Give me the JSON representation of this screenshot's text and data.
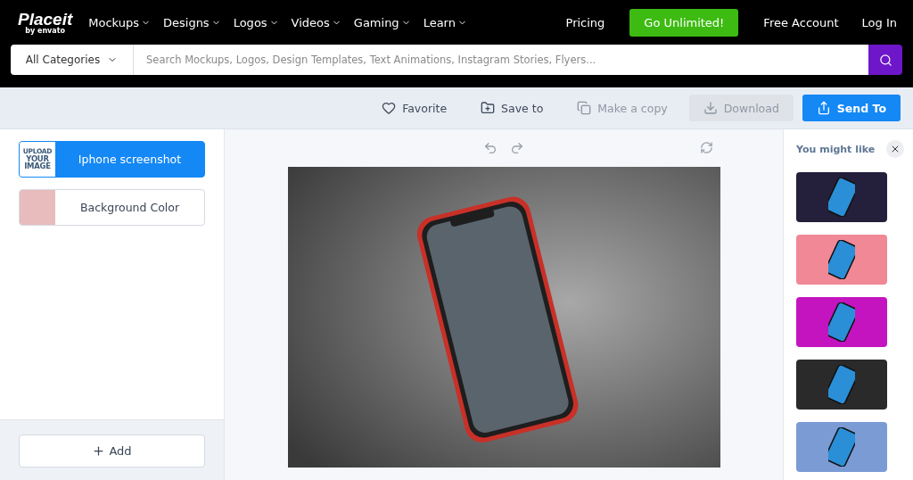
{
  "brand": {
    "name": "Placeit",
    "byline": "by",
    "partner": "envato"
  },
  "nav": [
    {
      "label": "Mockups"
    },
    {
      "label": "Designs"
    },
    {
      "label": "Logos"
    },
    {
      "label": "Videos"
    },
    {
      "label": "Gaming"
    },
    {
      "label": "Learn"
    }
  ],
  "top_links": [
    {
      "kind": "link",
      "label": "Pricing"
    },
    {
      "kind": "cta",
      "label": "Go Unlimited!"
    },
    {
      "kind": "link",
      "label": "Free Account"
    },
    {
      "kind": "link",
      "label": "Log In"
    }
  ],
  "search": {
    "category": "All Categories",
    "placeholder": "Search Mockups, Logos, Design Templates, Text Animations, Instagram Stories, Flyers..."
  },
  "toolbar": [
    {
      "kind": "favorite",
      "label": "Favorite",
      "disabled": false
    },
    {
      "kind": "save",
      "label": "Save to",
      "disabled": false
    },
    {
      "kind": "copy",
      "label": "Make a copy",
      "disabled": true
    },
    {
      "kind": "download",
      "label": "Download",
      "disabled": true
    },
    {
      "kind": "send",
      "label": "Send To",
      "disabled": false
    }
  ],
  "layers": [
    {
      "kind": "image",
      "label": "Iphone screenshot",
      "selected": true,
      "thumb_lines": [
        "UPLOAD",
        "YOUR",
        "IMAGE"
      ]
    },
    {
      "kind": "color",
      "label": "Background Color",
      "selected": false,
      "color": "#e8bcbc"
    }
  ],
  "add_button": {
    "label": "Add"
  },
  "suggestions": {
    "title": "You might like",
    "items": [
      {
        "color": "#241f3a"
      },
      {
        "color": "#f08896"
      },
      {
        "color": "#c414c0"
      },
      {
        "color": "#2a2a2a"
      },
      {
        "color": "#7b9bd4"
      }
    ]
  }
}
